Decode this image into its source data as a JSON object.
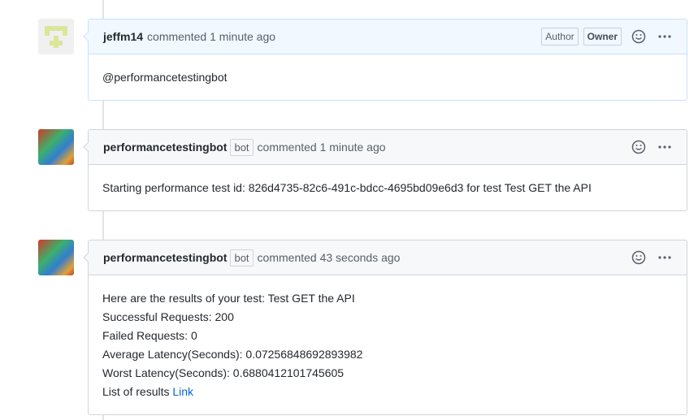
{
  "comments": [
    {
      "author": "jeffm14",
      "action": "commented",
      "time": "1 minute ago",
      "labels": [
        "Author",
        "Owner"
      ],
      "avatar": "identicon",
      "body": [
        "@performancetestingbot"
      ]
    },
    {
      "author": "performancetestingbot",
      "bot_label": "bot",
      "action": "commented",
      "time": "1 minute ago",
      "avatar": "bot-avatar",
      "body": [
        "Starting performance test id: 826d4735-82c6-491c-bdcc-4695bd09e6d3 for test Test GET the API"
      ]
    },
    {
      "author": "performancetestingbot",
      "bot_label": "bot",
      "action": "commented",
      "time": "43 seconds ago",
      "avatar": "bot-avatar",
      "body": [
        "Here are the results of your test: Test GET the API",
        "Successful Requests: 200",
        "Failed Requests: 0",
        "Average Latency(Seconds): 0.07256848692893982",
        "Worst Latency(Seconds): 0.6880412101745605",
        "List of results"
      ],
      "link_text": "Link"
    }
  ],
  "icons": {
    "reaction": "smiley-icon",
    "more": "kebab-horizontal-icon"
  },
  "colors": {
    "link": "#0366d6",
    "owner_header_bg": "#f1f8ff",
    "identicon": "#dbe69a"
  }
}
